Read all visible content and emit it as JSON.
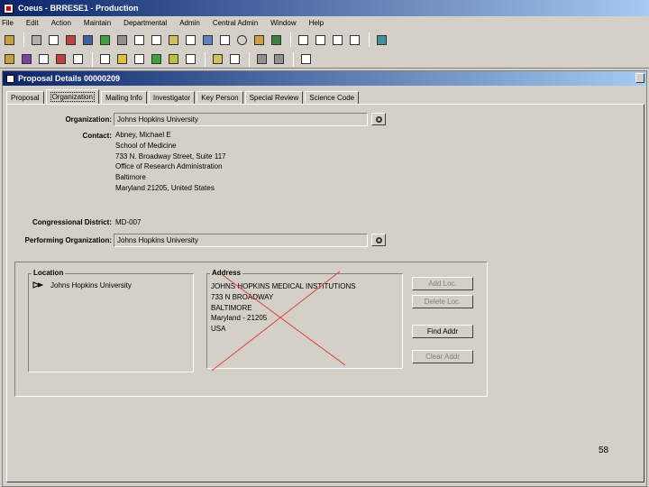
{
  "window": {
    "title": "Coeus - BRRESE1 - Production"
  },
  "menu": [
    "File",
    "Edit",
    "Action",
    "Maintain",
    "Departmental",
    "Admin",
    "Central Admin",
    "Window",
    "Help"
  ],
  "inner": {
    "title": "Proposal Details 00000209"
  },
  "tabs": [
    "Proposal",
    "Organization",
    "Mailing Info",
    "Investigator",
    "Key Person",
    "Special Review",
    "Science Code"
  ],
  "organization": {
    "org_label": "Organization:",
    "org_value": "Johns Hopkins University",
    "contact_label": "Contact:",
    "contact_lines": [
      "Abney, Michael E",
      "School of Medicine",
      "733 N. Broadway Street, Suite 117",
      "Office of Research Administration",
      "Baltimore",
      "Maryland 21205, United States"
    ],
    "district_label": "Congressional District:",
    "district_value": "MD-007",
    "perf_label": "Performing Organization:",
    "perf_value": "Johns Hopkins University"
  },
  "location_box": {
    "title": "Location",
    "item": "Johns Hopkins University"
  },
  "address_box": {
    "title": "Address",
    "lines": [
      "JOHNS HOPKINS MEDICAL INSTITUTIONS",
      "733 N BROADWAY",
      "BALTIMORE",
      "Maryland - 21205",
      "USA"
    ]
  },
  "buttons": {
    "add": "Add Loc.",
    "delete": "Delete Loc.",
    "find": "Find Addr",
    "clear": "Clear Addr"
  },
  "page_number": "58",
  "colors": {
    "title_bar": "#0a246a",
    "cross_out": "#e04040"
  }
}
